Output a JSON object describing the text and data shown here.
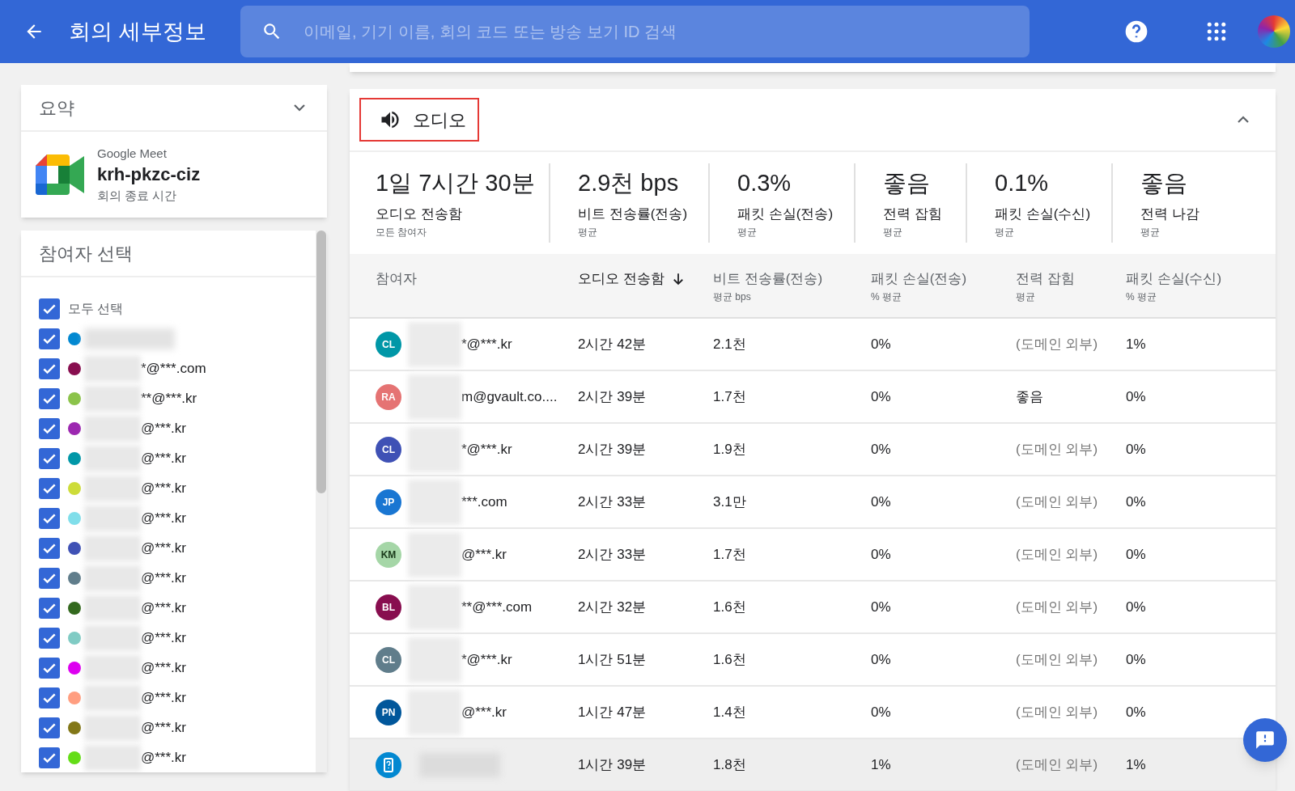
{
  "header": {
    "title": "회의 세부정보",
    "search": {
      "placeholder": "이메일, 기기 이름, 회의 코드 또는 방송 보기 ID 검색"
    }
  },
  "summary": {
    "title": "요약",
    "expanded": false,
    "app": "Google Meet",
    "meeting_code": "krh-pkzc-ciz",
    "status": "회의 종료 시간"
  },
  "participant_picker": {
    "title": "참여자 선택",
    "select_all": {
      "label": "모두 선택",
      "checked": true
    },
    "participants": [
      {
        "checked": true,
        "color": "#0288d1"
      },
      {
        "label": "*@***.com",
        "checked": true,
        "color": "#880e4f"
      },
      {
        "label": "**@***.kr",
        "checked": true,
        "color": "#8bc34a"
      },
      {
        "label": "@***.kr",
        "checked": true,
        "color": "#9c27b0"
      },
      {
        "label": "@***.kr",
        "checked": true,
        "color": "#0097a7"
      },
      {
        "label": "@***.kr",
        "checked": true,
        "color": "#cddc39"
      },
      {
        "label": "@***.kr",
        "checked": true,
        "color": "#80deea"
      },
      {
        "label": "@***.kr",
        "checked": true,
        "color": "#3f51b5"
      },
      {
        "label": "@***.kr",
        "checked": true,
        "color": "#607d8b"
      },
      {
        "label": "@***.kr",
        "checked": true,
        "color": "#33691e"
      },
      {
        "label": "@***.kr",
        "checked": true,
        "color": "#80cbc4"
      },
      {
        "label": "@***.kr",
        "checked": true,
        "color": "#dd00f0"
      },
      {
        "label": "@***.kr",
        "checked": true,
        "color": "#ff9e80"
      },
      {
        "label": "@***.kr",
        "checked": true,
        "color": "#827717"
      },
      {
        "label": "@***.kr",
        "checked": true,
        "color": "#64dd17"
      }
    ]
  },
  "audio": {
    "title": "오디오",
    "expanded": true,
    "stats": [
      {
        "value": "1일 7시간 30분",
        "label": "오디오 전송함",
        "sublabel": "모든 참여자"
      },
      {
        "value": "2.9천 bps",
        "label": "비트 전송률(전송)",
        "sublabel": "평균"
      },
      {
        "value": "0.3%",
        "label": "패킷 손실(전송)",
        "sublabel": "평균"
      },
      {
        "value": "좋음",
        "label": "전력 잡힘",
        "sublabel": "평균"
      },
      {
        "value": "0.1%",
        "label": "패킷 손실(수신)",
        "sublabel": "평균"
      },
      {
        "value": "좋음",
        "label": "전력 나감",
        "sublabel": "평균"
      }
    ],
    "table": {
      "columns": [
        {
          "label": "참여자",
          "sorted": false
        },
        {
          "label": "오디오 전송함",
          "sorted": true
        },
        {
          "label": "비트 전송률(전송)",
          "sublabel": "평균 bps",
          "sorted": false
        },
        {
          "label": "패킷 손실(전송)",
          "sublabel": "% 평균",
          "sorted": false
        },
        {
          "label": "전력 잡힘",
          "sublabel": "평균",
          "sorted": false
        },
        {
          "label": "패킷 손실(수신)",
          "sublabel": "% 평균",
          "sorted": false
        }
      ],
      "rows": [
        {
          "avatar": {
            "kind": "initials",
            "text": "CL",
            "color": "#0097a7"
          },
          "participant": "*@***.kr",
          "audio_sent": "2시간 42분",
          "bitrate": "2.1천",
          "packet_loss_sent": "0%",
          "noise": {
            "text": "(도메인 외부)",
            "out_of_domain": true
          },
          "packet_loss_received": "1%",
          "selected": false
        },
        {
          "avatar": {
            "kind": "initials",
            "text": "RA",
            "color": "#e57373"
          },
          "participant": "m@gvault.co....",
          "audio_sent": "2시간 39분",
          "bitrate": "1.7천",
          "packet_loss_sent": "0%",
          "noise": {
            "text": "좋음",
            "out_of_domain": false
          },
          "packet_loss_received": "0%",
          "selected": false
        },
        {
          "avatar": {
            "kind": "initials",
            "text": "CL",
            "color": "#3f51b5"
          },
          "participant": "*@***.kr",
          "audio_sent": "2시간 39분",
          "bitrate": "1.9천",
          "packet_loss_sent": "0%",
          "noise": {
            "text": "(도메인 외부)",
            "out_of_domain": true
          },
          "packet_loss_received": "0%",
          "selected": false
        },
        {
          "avatar": {
            "kind": "initials",
            "text": "JP",
            "color": "#1976d2"
          },
          "participant": "***.com",
          "audio_sent": "2시간 33분",
          "bitrate": "3.1만",
          "packet_loss_sent": "0%",
          "noise": {
            "text": "(도메인 외부)",
            "out_of_domain": true
          },
          "packet_loss_received": "0%",
          "selected": false
        },
        {
          "avatar": {
            "kind": "initials",
            "text": "KM",
            "color": "#a5d6a7"
          },
          "participant": "@***.kr",
          "audio_sent": "2시간 33분",
          "bitrate": "1.7천",
          "packet_loss_sent": "0%",
          "noise": {
            "text": "(도메인 외부)",
            "out_of_domain": true
          },
          "packet_loss_received": "0%",
          "selected": false
        },
        {
          "avatar": {
            "kind": "initials",
            "text": "BL",
            "color": "#880e4f"
          },
          "participant": "**@***.com",
          "audio_sent": "2시간 32분",
          "bitrate": "1.6천",
          "packet_loss_sent": "0%",
          "noise": {
            "text": "(도메인 외부)",
            "out_of_domain": true
          },
          "packet_loss_received": "0%",
          "selected": false
        },
        {
          "avatar": {
            "kind": "initials",
            "text": "CL",
            "color": "#607d8b"
          },
          "participant": "*@***.kr",
          "audio_sent": "1시간 51분",
          "bitrate": "1.6천",
          "packet_loss_sent": "0%",
          "noise": {
            "text": "(도메인 외부)",
            "out_of_domain": true
          },
          "packet_loss_received": "0%",
          "selected": false
        },
        {
          "avatar": {
            "kind": "initials",
            "text": "PN",
            "color": "#01579b"
          },
          "participant": "@***.kr",
          "audio_sent": "1시간 47분",
          "bitrate": "1.4천",
          "packet_loss_sent": "0%",
          "noise": {
            "text": "(도메인 외부)",
            "out_of_domain": true
          },
          "packet_loss_received": "0%",
          "selected": false
        },
        {
          "avatar": {
            "kind": "device",
            "color": "#0288d1"
          },
          "audio_sent": "1시간 39분",
          "bitrate": "1.8천",
          "packet_loss_sent": "1%",
          "noise": {
            "text": "(도메인 외부)",
            "out_of_domain": true
          },
          "packet_loss_received": "1%",
          "selected": true
        }
      ]
    }
  }
}
